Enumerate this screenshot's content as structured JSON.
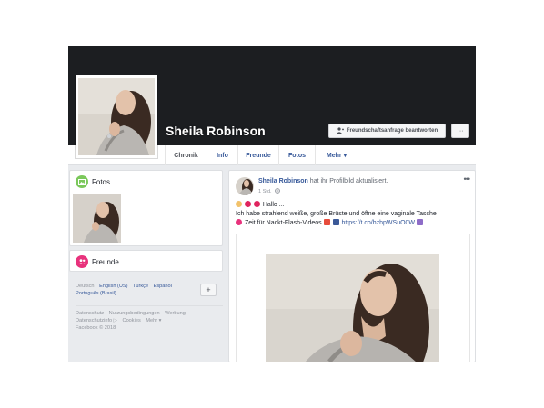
{
  "profile": {
    "name": "Sheila Robinson",
    "friend_request_label": "Freundschaftsanfrage beantworten",
    "more_label": "···"
  },
  "tabs": [
    {
      "label": "Chronik",
      "active": true
    },
    {
      "label": "Info"
    },
    {
      "label": "Freunde"
    },
    {
      "label": "Fotos"
    },
    {
      "label": "Mehr ▾"
    }
  ],
  "sidebar": {
    "fotos_title": "Fotos",
    "freunde_title": "Freunde",
    "languages": {
      "current": "Deutsch",
      "links": [
        "English (US)",
        "Türkçe",
        "Español",
        "Português (Brasil)"
      ],
      "add_label": "+"
    },
    "footer": {
      "links": [
        "Datenschutz",
        "Nutzungsbedingungen",
        "Werbung",
        "Datenschutzinfo ▷",
        "Cookies",
        "Mehr ▾"
      ],
      "copyright": "Facebook © 2018"
    }
  },
  "post": {
    "author": "Sheila Robinson",
    "action": "hat ihr Profilbild aktualisiert.",
    "time": "1 Std.",
    "menu": "•••",
    "greeting": "Hallo ...",
    "line2": "Ich habe strahlend weiße, große Brüste und öffne eine vaginale Tasche",
    "line3": "Zeit für Nackt-Flash-Videos",
    "link": "https://t.co/hzhpWSuO0W"
  },
  "colors": {
    "cover": "#1c1e21",
    "link": "#365899",
    "page_bg": "#e9ebee",
    "fotos_icon": "#7bc85b",
    "freunde_icon": "#e8327c"
  }
}
